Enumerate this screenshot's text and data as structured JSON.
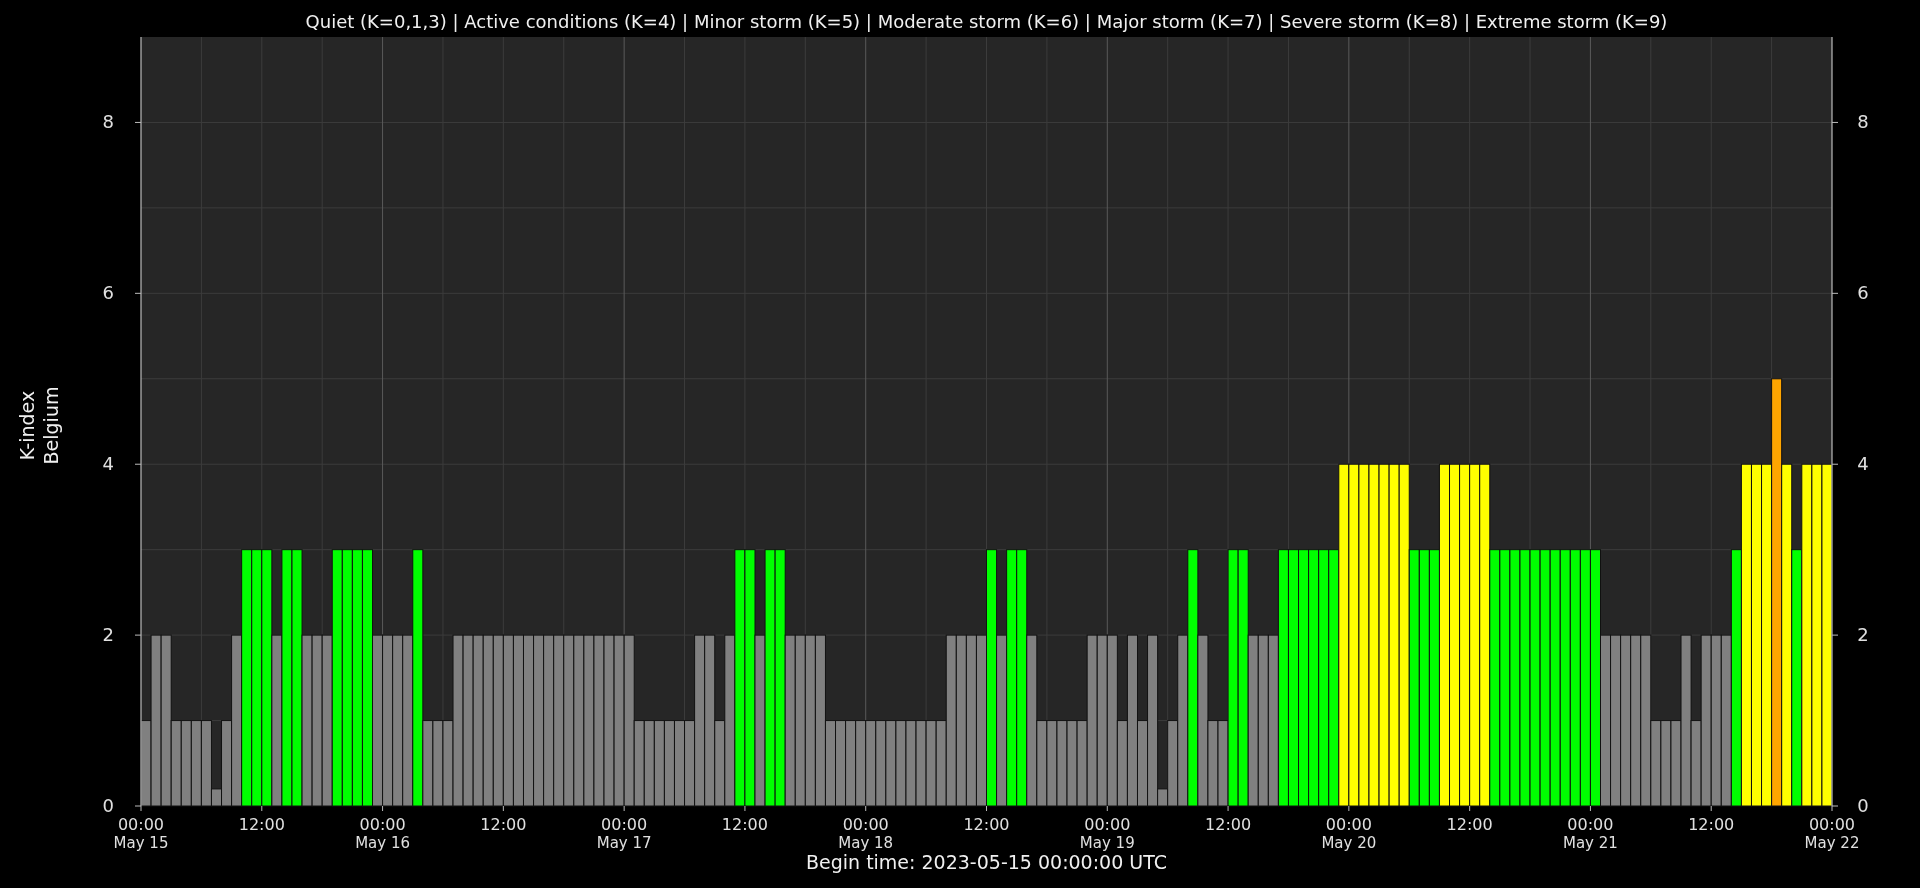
{
  "chart_data": {
    "type": "bar",
    "title": "Quiet (K=0,1,3) | Active conditions (K=4) | Minor storm (K=5) | Moderate storm (K=6) | Major storm (K=7) | Severe storm (K=8) | Extreme storm (K=9)",
    "xlabel": "Begin time: 2023-05-15 00:00:00 UTC",
    "ylabel": "K-index",
    "ylim": [
      0,
      9
    ],
    "yticks": [
      {
        "value": 0,
        "label": "0"
      },
      {
        "value": 2,
        "label": "2"
      },
      {
        "value": 4,
        "label": "4"
      },
      {
        "value": 6,
        "label": "6"
      },
      {
        "value": 8,
        "label": "8"
      }
    ],
    "grid": true,
    "values": [
      1,
      2,
      2,
      1,
      1,
      1,
      1,
      0.2,
      1,
      2,
      3,
      3,
      3,
      2,
      3,
      3,
      2,
      2,
      2,
      3,
      3,
      3,
      3,
      2,
      2,
      2,
      2,
      3,
      1,
      1,
      1,
      2,
      2,
      2,
      2,
      2,
      2,
      2,
      2,
      2,
      2,
      2,
      2,
      2,
      2,
      2,
      2,
      2,
      2,
      1,
      1,
      1,
      1,
      1,
      1,
      2,
      2,
      1,
      2,
      3,
      3,
      2,
      3,
      3,
      2,
      2,
      2,
      2,
      1,
      1,
      1,
      1,
      1,
      1,
      1,
      1,
      1,
      1,
      1,
      1,
      2,
      2,
      2,
      2,
      3,
      2,
      3,
      3,
      2,
      1,
      1,
      1,
      1,
      1,
      2,
      2,
      2,
      1,
      2,
      1,
      2,
      0.2,
      1,
      2,
      3,
      2,
      1,
      1,
      3,
      3,
      2,
      2,
      2,
      3,
      3,
      3,
      3,
      3,
      3,
      4,
      4,
      4,
      4,
      4,
      4,
      4,
      3,
      3,
      3,
      4,
      4,
      4,
      4,
      4,
      3,
      3,
      3,
      3,
      3,
      3,
      3,
      3,
      3,
      3,
      3,
      2,
      2,
      2,
      2,
      2,
      1,
      1,
      1,
      2,
      1,
      2,
      2,
      2,
      3,
      4,
      4,
      4,
      5,
      4,
      3,
      4,
      4,
      4
    ]
  },
  "y_axis_subtitle": "Belgium",
  "right_axis_ticks": [
    "8",
    "6",
    "4",
    "2",
    "0"
  ],
  "time_labels": [
    "00:00",
    "12:00",
    "00:00",
    "12:00",
    "00:00",
    "12:00",
    "00:00",
    "12:00",
    "00:00",
    "12:00",
    "00:00",
    "12:00",
    "00:00",
    "12:00",
    "00:00"
  ],
  "date_labels": [
    "May 15",
    "May 16",
    "May 17",
    "May 18",
    "May 19",
    "May 20",
    "May 21",
    "May 22"
  ]
}
